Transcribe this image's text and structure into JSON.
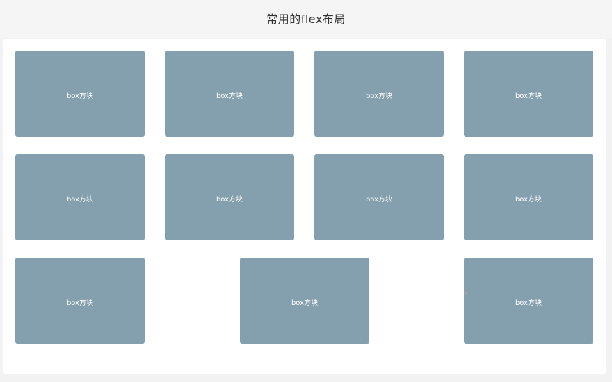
{
  "header": {
    "title": "常用的flex布局"
  },
  "rows": [
    {
      "boxes": [
        {
          "label": "box方块"
        },
        {
          "label": "box方块"
        },
        {
          "label": "box方块"
        },
        {
          "label": "box方块"
        }
      ]
    },
    {
      "boxes": [
        {
          "label": "box方块"
        },
        {
          "label": "box方块"
        },
        {
          "label": "box方块"
        },
        {
          "label": "box方块"
        }
      ]
    },
    {
      "boxes": [
        {
          "label": "box方块"
        },
        {
          "label": "box方块"
        },
        {
          "label": "box方块"
        }
      ]
    }
  ],
  "colors": {
    "box": "#849fad",
    "panel": "#ffffff",
    "background": "#f2f2f2"
  }
}
